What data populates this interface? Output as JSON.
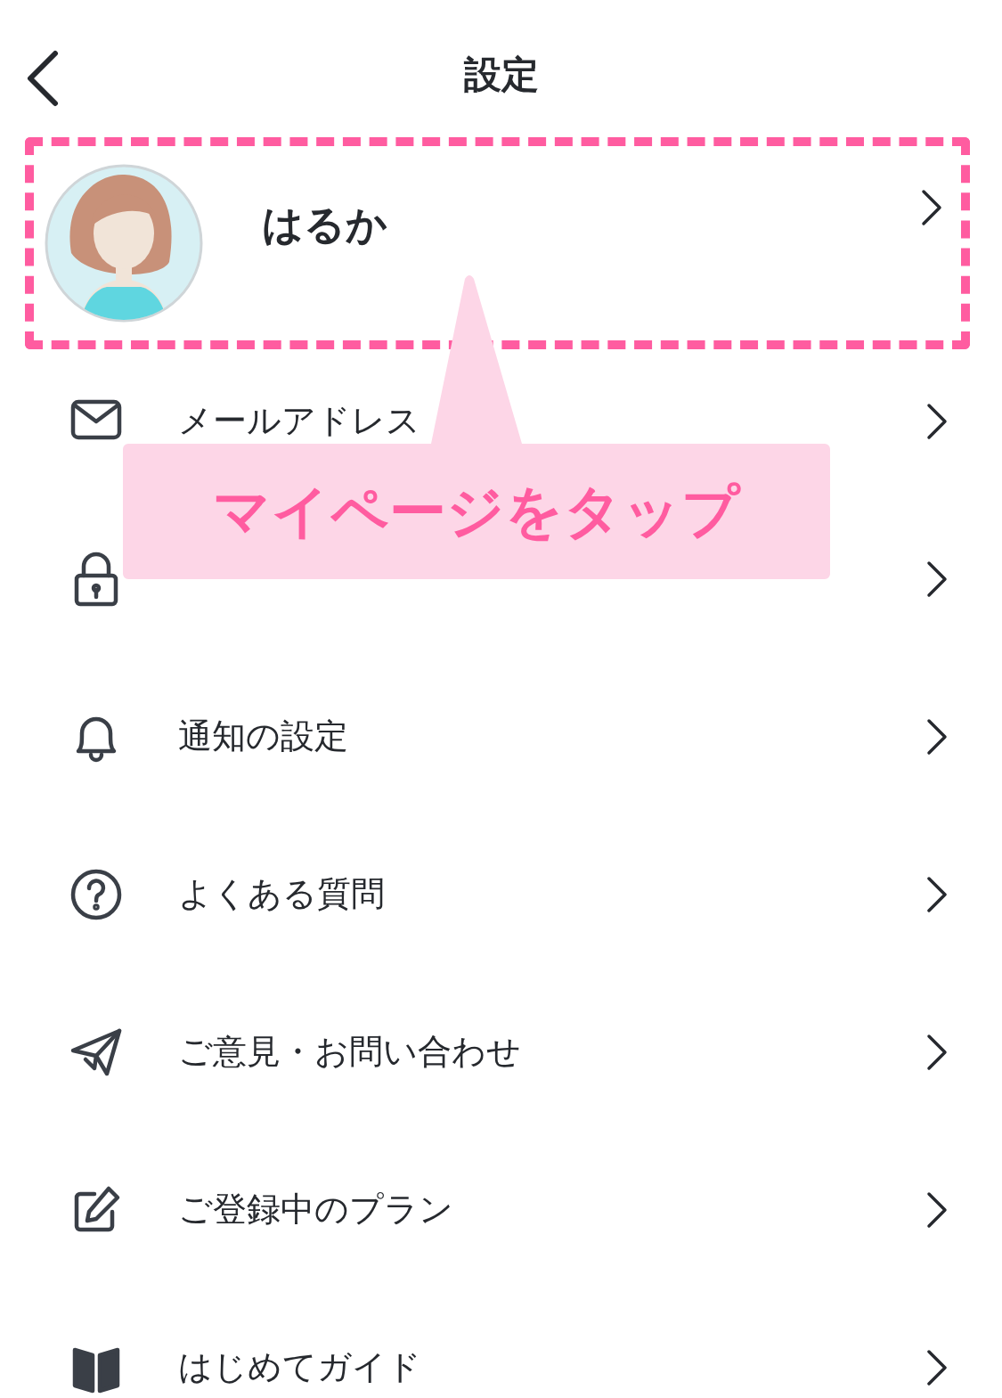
{
  "header": {
    "title": "設定"
  },
  "profile": {
    "name": "はるか",
    "highlighted": true
  },
  "menu": [
    {
      "kind": "mail",
      "label": "メールアドレス"
    },
    {
      "kind": "lock"
    },
    {
      "kind": "bell",
      "label": "通知の設定"
    },
    {
      "kind": "help",
      "label": "よくある質問"
    },
    {
      "kind": "send",
      "label": "ご意見・お問い合わせ"
    },
    {
      "kind": "edit",
      "label": "ご登録中のプラン"
    },
    {
      "kind": "book",
      "label": "はじめてガイド"
    }
  ],
  "callout": {
    "text": "マイページをタップ"
  }
}
